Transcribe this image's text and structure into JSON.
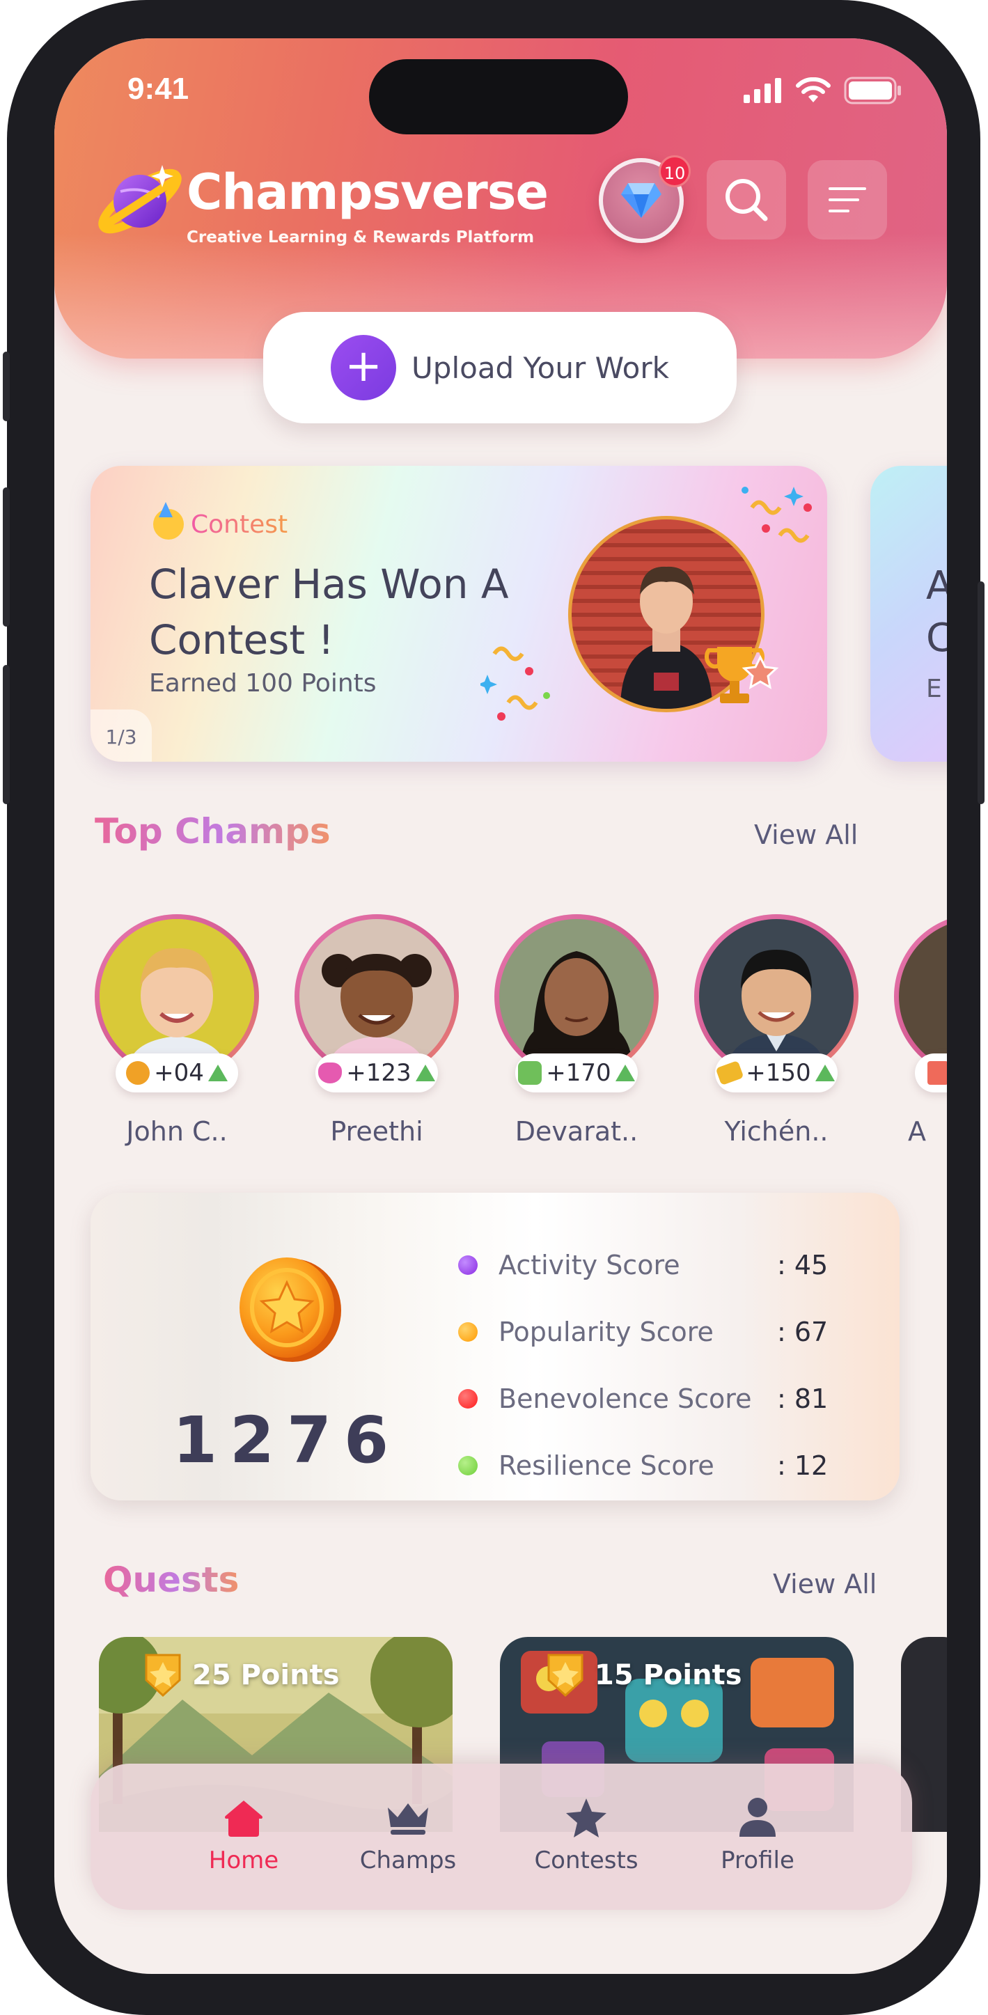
{
  "status_bar": {
    "time": "9:41"
  },
  "header": {
    "brand": "Champsverse",
    "tagline": "Creative Learning & Rewards Platform",
    "notification_count": "10"
  },
  "upload": {
    "label": "Upload Your Work"
  },
  "contest_cards": [
    {
      "tag": "Contest",
      "title": "Claver Has Won A Contest !",
      "subtitle": "Earned 100 Points",
      "position": "1/3"
    },
    {
      "title_partial": "A\nC",
      "subtitle_partial": "E"
    }
  ],
  "top_champs": {
    "title": "Top Champs",
    "view_all": "View All",
    "items": [
      {
        "name": "John C..",
        "score": "+04"
      },
      {
        "name": "Preethi",
        "score": "+123"
      },
      {
        "name": "Devarat..",
        "score": "+170"
      },
      {
        "name": "Yichén..",
        "score": "+150"
      },
      {
        "name": "A"
      }
    ]
  },
  "score_card": {
    "total": "1276",
    "rows": [
      {
        "label": "Activity Score",
        "value": ": 45",
        "color": "#8a2be2"
      },
      {
        "label": "Popularity Score",
        "value": ": 67",
        "color": "#ff9a00"
      },
      {
        "label": "Benevolence Score",
        "value": ": 81",
        "color": "#ff1a1a"
      },
      {
        "label": "Resilience Score",
        "value": ": 12",
        "color": "#6fcf3a"
      }
    ]
  },
  "quests": {
    "title": "Quests",
    "view_all": "View All",
    "items": [
      {
        "points": "25 Points"
      },
      {
        "points": "15 Points"
      }
    ]
  },
  "bottom_nav": {
    "items": [
      {
        "label": "Home",
        "icon": "home-icon",
        "active": true
      },
      {
        "label": "Champs",
        "icon": "crown-icon"
      },
      {
        "label": "Contests",
        "icon": "star-icon"
      },
      {
        "label": "Profile",
        "icon": "person-icon"
      }
    ],
    "active_color": "#ef2a54"
  }
}
